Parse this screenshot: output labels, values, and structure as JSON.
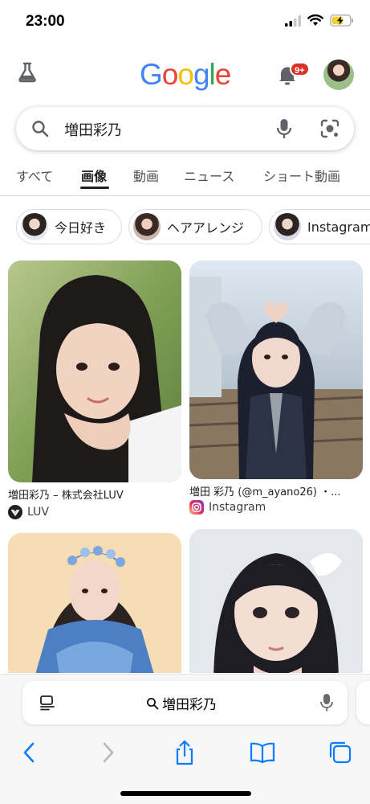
{
  "status_bar": {
    "time": "23:00"
  },
  "header": {
    "logo_letters": [
      {
        "ch": "G",
        "color": "#4285F4"
      },
      {
        "ch": "o",
        "color": "#EA4335"
      },
      {
        "ch": "o",
        "color": "#FBBC05"
      },
      {
        "ch": "g",
        "color": "#4285F4"
      },
      {
        "ch": "l",
        "color": "#34A853"
      },
      {
        "ch": "e",
        "color": "#EA4335"
      }
    ],
    "notification_badge": "9+"
  },
  "search": {
    "query": "増田彩乃"
  },
  "tabs": [
    {
      "label": "すべて",
      "active": false
    },
    {
      "label": "画像",
      "active": true
    },
    {
      "label": "動画",
      "active": false
    },
    {
      "label": "ニュース",
      "active": false
    },
    {
      "label": "ショート動画",
      "active": false
    }
  ],
  "chips": [
    {
      "label": "今日好き"
    },
    {
      "label": "ヘアアレンジ"
    },
    {
      "label": "Instagram"
    }
  ],
  "results": [
    {
      "title": "増田彩乃 – 株式会社LUV",
      "source": "LUV"
    },
    {
      "title": "増田 彩乃 (@m_ayano26) ・...",
      "source": "Instagram"
    }
  ],
  "address_bar": {
    "text": "増田彩乃"
  },
  "colors": {
    "accent": "#1a73e8",
    "badge": "#d93025",
    "ios_blue": "#0a7aff"
  }
}
